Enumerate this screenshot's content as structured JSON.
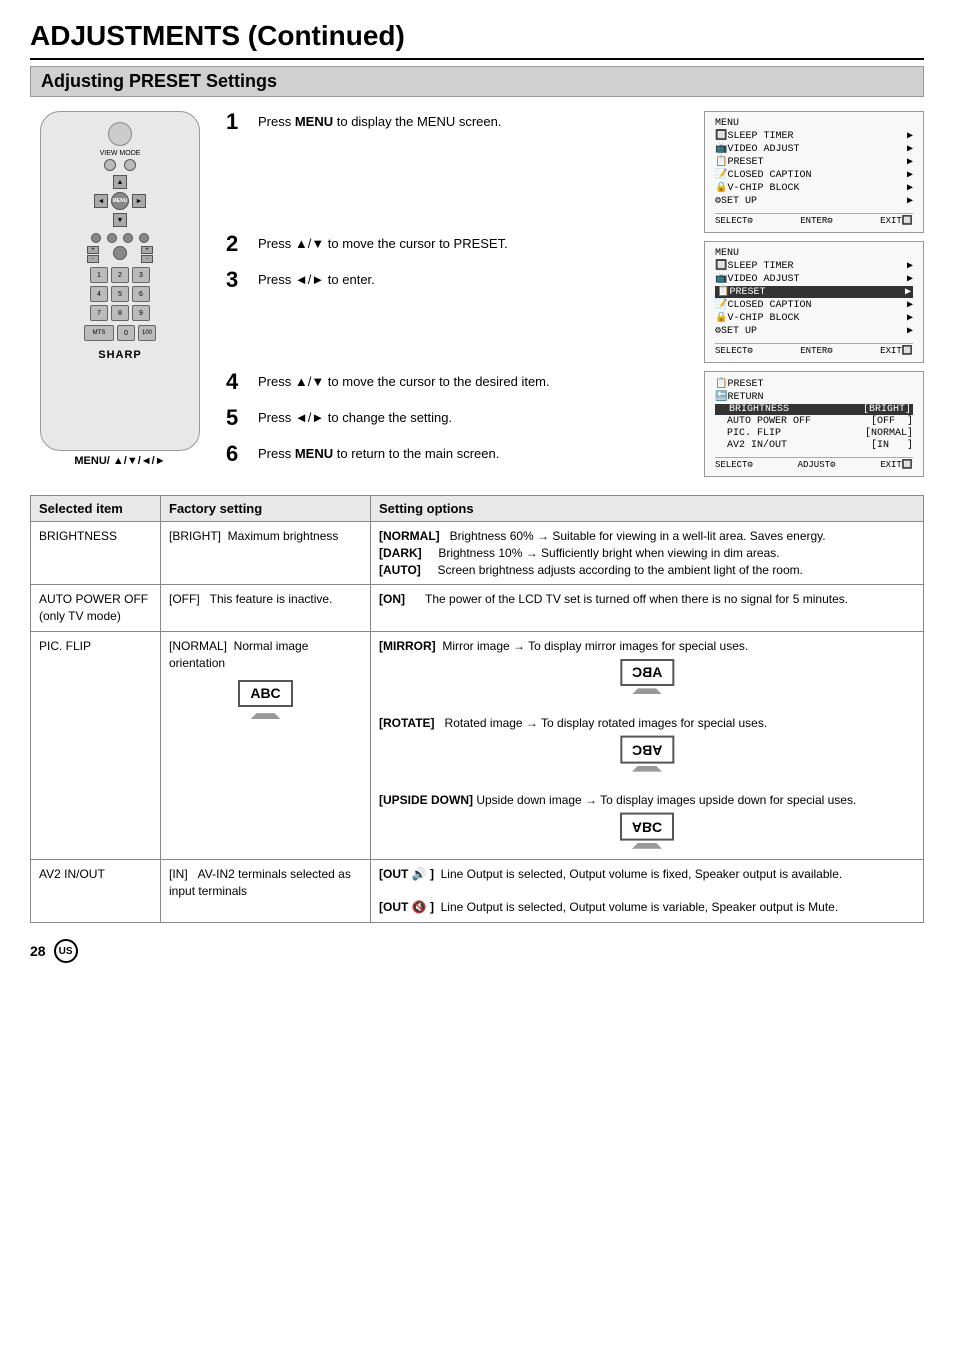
{
  "page": {
    "title": "ADJUSTMENTS (Continued)",
    "section": "Adjusting PRESET Settings",
    "page_number": "28",
    "badge": "US"
  },
  "steps": [
    {
      "num": "1",
      "text": "Press MENU to display the MENU screen."
    },
    {
      "num": "2",
      "text": "Press ▲/▼ to move the cursor to PRESET."
    },
    {
      "num": "3",
      "text": "Press ◄/► to enter."
    },
    {
      "num": "4",
      "text": "Press ▲/▼ to move the cursor to the desired item."
    },
    {
      "num": "5",
      "text": "Press ◄/► to change the setting."
    },
    {
      "num": "6",
      "text": "Press MENU to return to the main screen."
    }
  ],
  "menu_label": "MENU/ ▲/▼/◄/►",
  "screens": [
    {
      "id": "screen1",
      "rows": [
        {
          "text": "MENU",
          "right": "",
          "highlighted": false
        },
        {
          "text": "🔲SLEEP TIMER",
          "right": "▶",
          "highlighted": false
        },
        {
          "text": "📺VIDEO ADJUST",
          "right": "▶",
          "highlighted": false
        },
        {
          "text": "📋PRESET",
          "right": "▶",
          "highlighted": false
        },
        {
          "text": "📝CLOSED CAPTION",
          "right": "▶",
          "highlighted": false
        },
        {
          "text": "🔒V-CHIP BLOCK",
          "right": "▶",
          "highlighted": false
        },
        {
          "text": "⚙SET UP",
          "right": "▶",
          "highlighted": false
        }
      ],
      "footer": [
        "SELECT",
        "ENTER",
        "EXIT"
      ]
    },
    {
      "id": "screen2",
      "rows": [
        {
          "text": "MENU",
          "right": "",
          "highlighted": false
        },
        {
          "text": "🔲SLEEP TIMER",
          "right": "▶",
          "highlighted": false
        },
        {
          "text": "📺VIDEO ADJUST",
          "right": "▶",
          "highlighted": false
        },
        {
          "text": "📋PRESET",
          "right": "▶",
          "highlighted": true
        },
        {
          "text": "📝CLOSED CAPTION",
          "right": "▶",
          "highlighted": false
        },
        {
          "text": "🔒V-CHIP BLOCK",
          "right": "▶",
          "highlighted": false
        },
        {
          "text": "⚙SET UP",
          "right": "▶",
          "highlighted": false
        }
      ],
      "footer": [
        "SELECT",
        "ENTER",
        "EXIT"
      ]
    },
    {
      "id": "screen3",
      "rows": [
        {
          "text": "📋PRESET",
          "right": "",
          "highlighted": false
        },
        {
          "text": "🔙RETURN",
          "right": "",
          "highlighted": false
        },
        {
          "text": "BRIGHTNESS",
          "right": "[BRIGHT]",
          "highlighted": true
        },
        {
          "text": "AUTO POWER OFF",
          "right": "[OFF  ]",
          "highlighted": false
        },
        {
          "text": "PIC. FLIP",
          "right": "[NORMAL]",
          "highlighted": false
        },
        {
          "text": "AV2 IN/OUT",
          "right": "[IN   ]",
          "highlighted": false
        }
      ],
      "footer": [
        "SELECT",
        "ADJUST",
        "EXIT"
      ]
    }
  ],
  "table": {
    "headers": [
      "Selected item",
      "Factory setting",
      "Setting options"
    ],
    "rows": [
      {
        "item": "BRIGHTNESS",
        "factory": "[BRIGHT]    Maximum brightness",
        "options": "[NORMAL]  Brightness 60% → Suitable for viewing in a well-lit area. Saves energy.\n[DARK]      Brightness 10% → Sufficiently bright when viewing in dim areas.\n[AUTO]      Screen brightness adjusts according to the ambient light of the room."
      },
      {
        "item": "AUTO POWER OFF\n(only TV mode)",
        "factory": "[OFF]    This feature is inactive.",
        "options": "[ON]      The power of the LCD TV set is turned off when there is no signal for 5 minutes."
      },
      {
        "item": "PIC. FLIP",
        "factory": "[NORMAL]  Normal image orientation\n[ABC_NORMAL]",
        "options_complex": true,
        "options": "[MIRROR]  Mirror image → To display mirror images for special uses.\n[ABC_MIRROR]\n[ROTATE]   Rotated image → To display rotated images for special uses.\n[ABC_ROTATE]\n[UPSIDE DOWN]  Upside down image → To display images upside down for special uses.\n[ABC_UPDOWN]"
      },
      {
        "item": "AV2 IN/OUT",
        "factory": "[IN]    AV-IN2 terminals selected as input terminals",
        "options": "[OUT 🔊 ]  Line Output is selected, Output volume is fixed, Speaker output is available.\n[OUT 🔇 ]  Line Output is selected, Output volume is variable, Speaker output is Mute."
      }
    ]
  }
}
